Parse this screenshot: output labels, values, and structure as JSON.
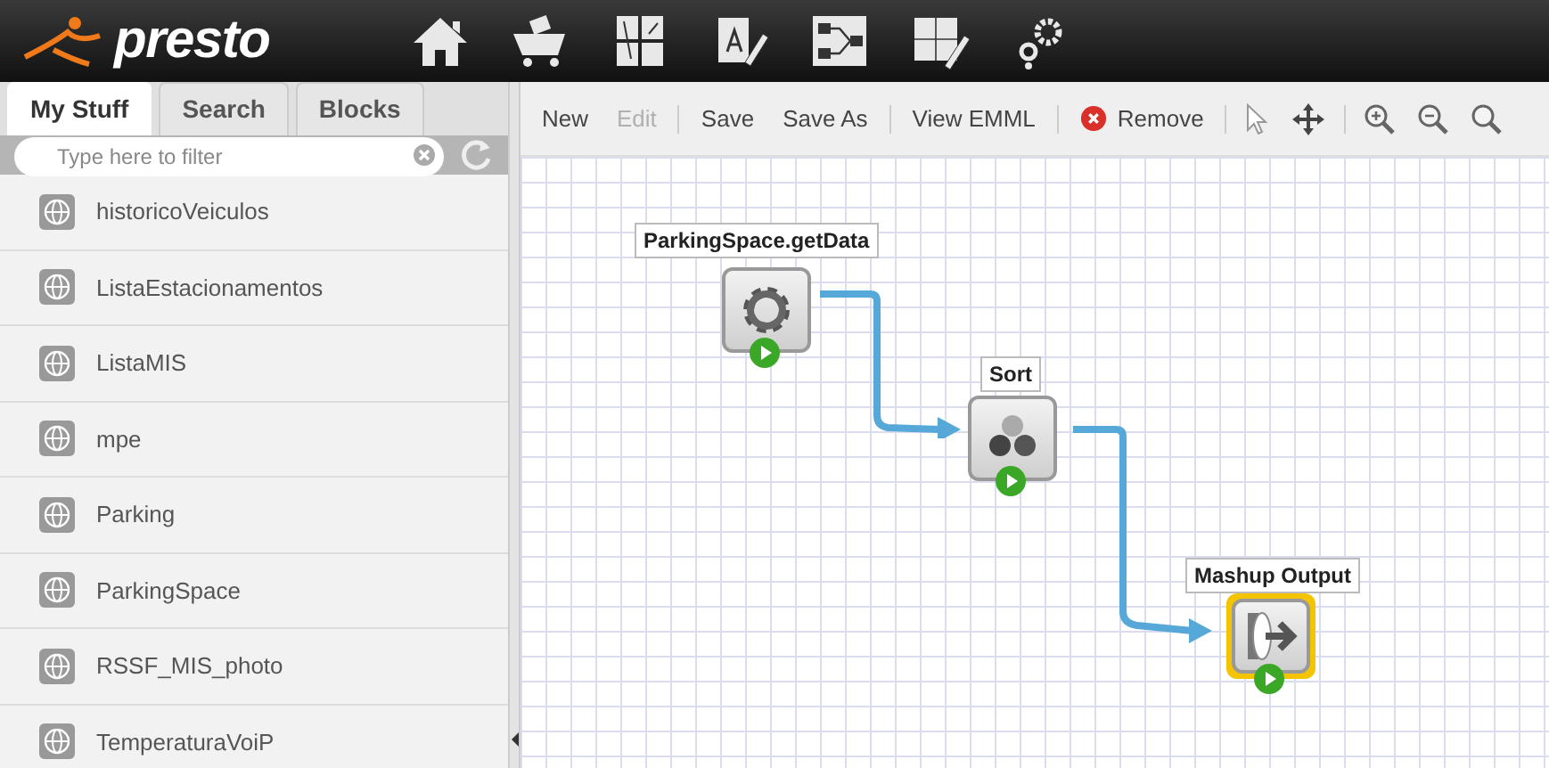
{
  "app": {
    "logo": "presto"
  },
  "nav": [
    {
      "kind": "home"
    },
    {
      "kind": "cart"
    },
    {
      "kind": "grid"
    },
    {
      "kind": "edit"
    },
    {
      "kind": "flow"
    },
    {
      "kind": "puzzle"
    },
    {
      "kind": "gears"
    }
  ],
  "tabs": [
    {
      "label": "My Stuff",
      "selected": true
    },
    {
      "label": "Search",
      "selected": false
    },
    {
      "label": "Blocks",
      "selected": false
    }
  ],
  "filter": {
    "placeholder": "Type here to filter"
  },
  "items": [
    "historicoVeiculos",
    "ListaEstacionamentos",
    "ListaMIS",
    "mpe",
    "Parking",
    "ParkingSpace",
    "RSSF_MIS_photo",
    "TemperaturaVoiP"
  ],
  "toolbar": [
    {
      "kind": "text",
      "label": "New",
      "disabled": false
    },
    {
      "kind": "text",
      "label": "Edit",
      "disabled": true
    },
    {
      "kind": "sep"
    },
    {
      "kind": "text",
      "label": "Save",
      "disabled": false
    },
    {
      "kind": "text",
      "label": "Save As",
      "disabled": false
    },
    {
      "kind": "sep"
    },
    {
      "kind": "text",
      "label": "View EMML",
      "disabled": false
    },
    {
      "kind": "sep"
    },
    {
      "kind": "remove",
      "label": "Remove",
      "disabled": false
    },
    {
      "kind": "sep"
    },
    {
      "kind": "pointer"
    },
    {
      "kind": "move"
    },
    {
      "kind": "sep"
    },
    {
      "kind": "zoomin"
    },
    {
      "kind": "zoomout"
    },
    {
      "kind": "zoom"
    }
  ],
  "nodes": [
    {
      "title": "ParkingSpace.getData",
      "kind": "service",
      "selected": false
    },
    {
      "title": "Sort",
      "kind": "sort",
      "selected": false
    },
    {
      "title": "Mashup Output",
      "kind": "output",
      "selected": true
    }
  ]
}
